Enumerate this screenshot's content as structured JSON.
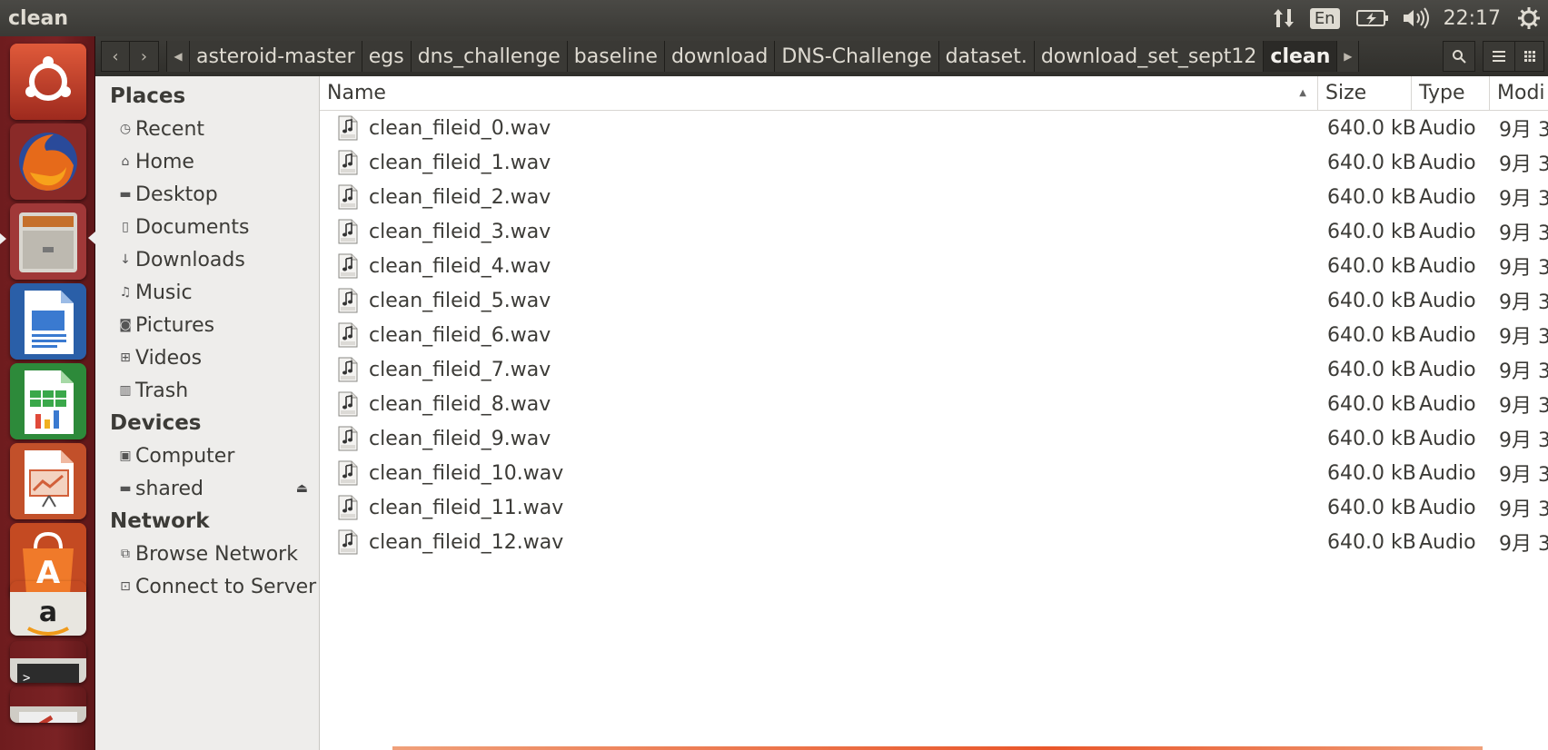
{
  "window": {
    "title": "clean"
  },
  "panel": {
    "language": "En",
    "time": "22:17"
  },
  "toolbar": {
    "back_label": "‹",
    "forward_label": "›",
    "breadcrumbs": [
      "asteroid-master",
      "egs",
      "dns_challenge",
      "baseline",
      "download",
      "DNS-Challenge",
      "dataset.",
      "download_set_sept12",
      "clean"
    ]
  },
  "sidebar": {
    "places_heading": "Places",
    "places": [
      {
        "label": "Recent",
        "icon": "clock-icon"
      },
      {
        "label": "Home",
        "icon": "home-icon"
      },
      {
        "label": "Desktop",
        "icon": "folder-icon"
      },
      {
        "label": "Documents",
        "icon": "document-icon"
      },
      {
        "label": "Downloads",
        "icon": "download-icon"
      },
      {
        "label": "Music",
        "icon": "music-icon"
      },
      {
        "label": "Pictures",
        "icon": "camera-icon"
      },
      {
        "label": "Videos",
        "icon": "film-icon"
      },
      {
        "label": "Trash",
        "icon": "trash-icon"
      }
    ],
    "devices_heading": "Devices",
    "devices": [
      {
        "label": "Computer",
        "icon": "computer-icon"
      },
      {
        "label": "shared",
        "icon": "drive-icon"
      }
    ],
    "network_heading": "Network",
    "network": [
      {
        "label": "Browse Network",
        "icon": "network-icon"
      },
      {
        "label": "Connect to Server",
        "icon": "server-icon"
      }
    ]
  },
  "list": {
    "columns": {
      "name": "Name",
      "size": "Size",
      "type": "Type",
      "modified": "Modi"
    },
    "files": [
      {
        "name": "clean_fileid_0.wav",
        "size": "640.0 kB",
        "type": "Audio",
        "modified": "9月 3"
      },
      {
        "name": "clean_fileid_1.wav",
        "size": "640.0 kB",
        "type": "Audio",
        "modified": "9月 3"
      },
      {
        "name": "clean_fileid_2.wav",
        "size": "640.0 kB",
        "type": "Audio",
        "modified": "9月 3"
      },
      {
        "name": "clean_fileid_3.wav",
        "size": "640.0 kB",
        "type": "Audio",
        "modified": "9月 3"
      },
      {
        "name": "clean_fileid_4.wav",
        "size": "640.0 kB",
        "type": "Audio",
        "modified": "9月 3"
      },
      {
        "name": "clean_fileid_5.wav",
        "size": "640.0 kB",
        "type": "Audio",
        "modified": "9月 3"
      },
      {
        "name": "clean_fileid_6.wav",
        "size": "640.0 kB",
        "type": "Audio",
        "modified": "9月 3"
      },
      {
        "name": "clean_fileid_7.wav",
        "size": "640.0 kB",
        "type": "Audio",
        "modified": "9月 3"
      },
      {
        "name": "clean_fileid_8.wav",
        "size": "640.0 kB",
        "type": "Audio",
        "modified": "9月 3"
      },
      {
        "name": "clean_fileid_9.wav",
        "size": "640.0 kB",
        "type": "Audio",
        "modified": "9月 3"
      },
      {
        "name": "clean_fileid_10.wav",
        "size": "640.0 kB",
        "type": "Audio",
        "modified": "9月 3"
      },
      {
        "name": "clean_fileid_11.wav",
        "size": "640.0 kB",
        "type": "Audio",
        "modified": "9月 3"
      },
      {
        "name": "clean_fileid_12.wav",
        "size": "640.0 kB",
        "type": "Audio",
        "modified": "9月 3"
      }
    ]
  },
  "colors": {
    "launcher": "#7a2224",
    "panel": "#3c3b37",
    "accent": "#e9562a"
  }
}
